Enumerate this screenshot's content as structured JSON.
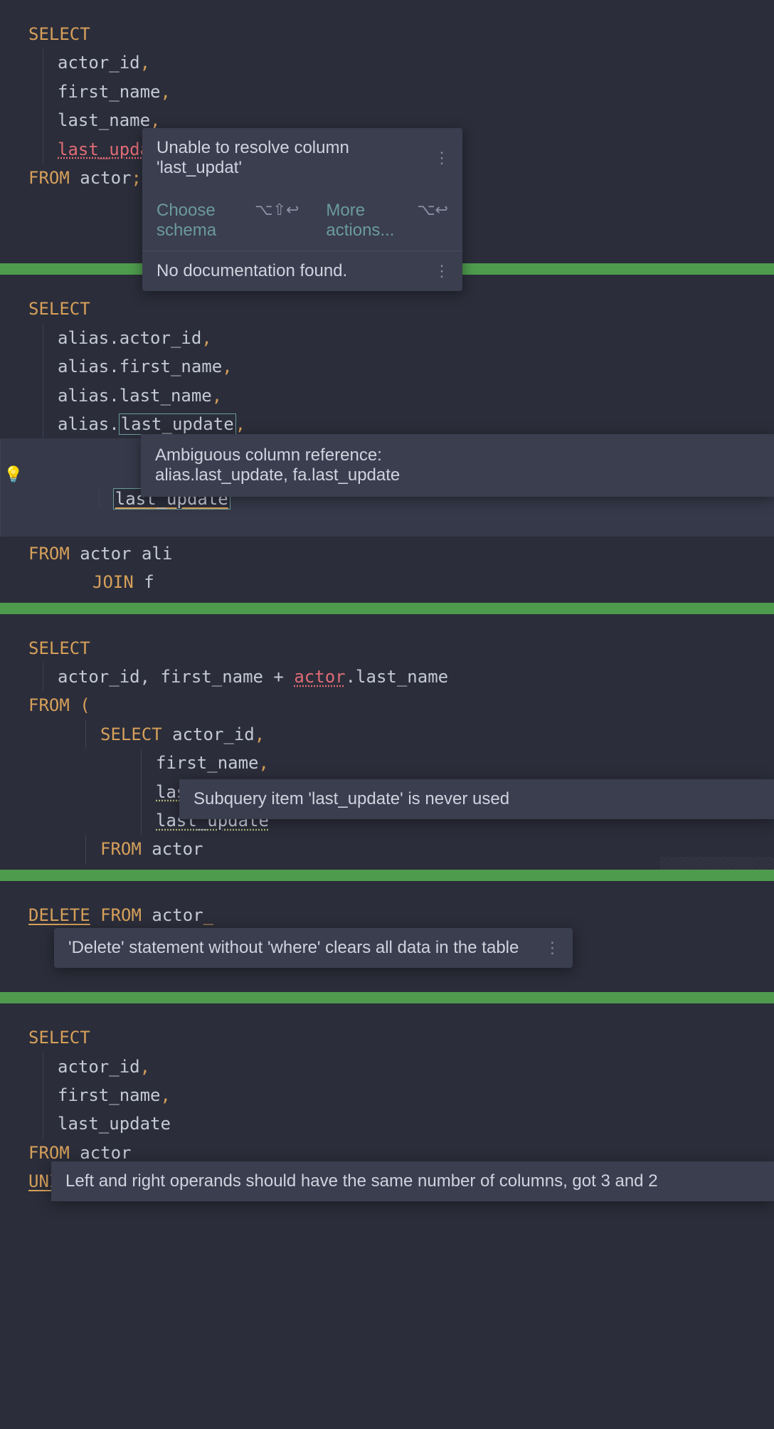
{
  "section1": {
    "code": {
      "select": "SELECT",
      "col1": "actor_id",
      "col2": "first_name",
      "col3": "last_name",
      "col4_err": "last_updat",
      "from": "FROM",
      "table": "actor",
      "semi": ";"
    },
    "popup": {
      "title": "Unable to resolve column 'last_updat'",
      "action1": "Choose schema",
      "shortcut1": "⌥⇧↩",
      "action2": "More actions...",
      "shortcut2": "⌥↩",
      "docmsg": "No documentation found."
    }
  },
  "section2": {
    "code": {
      "select": "SELECT",
      "c1": "alias.actor_id",
      "c2": "alias.first_name",
      "c3": "alias.last_name",
      "c4_pre": "alias.",
      "c4_box": "last_update",
      "c5_box": "last_update",
      "from": "FROM",
      "table": "actor",
      "alias": "ali",
      "join": "JOIN",
      "jtbl": "f"
    },
    "tooltip": "Ambiguous column reference: alias.last_update, fa.last_update"
  },
  "section3": {
    "code": {
      "select": "SELECT",
      "expr_pre": "actor_id, first_name + ",
      "expr_err": "actor",
      "expr_post": ".last_name",
      "from": "FROM",
      "paren": "(",
      "sub_select": "SELECT",
      "sc1": "actor_id",
      "sc2": "first_name",
      "sc3": "last_name",
      "sc4": "last_update",
      "sub_from": "FROM",
      "sub_table": "actor"
    },
    "tooltip": "Subquery item 'last_update' is never used"
  },
  "section4": {
    "code": {
      "delete": "DELETE",
      "from": "FROM",
      "table": "actor"
    },
    "tooltip": "'Delete' statement without 'where' clears all data in the table"
  },
  "section5": {
    "code": {
      "select": "SELECT",
      "c1": "actor_id",
      "c2": "first_name",
      "c3": "last_update",
      "from": "FROM",
      "table": "actor",
      "union": "UNION"
    },
    "tooltip": "Left and right operands should have the same number of columns, got 3 and 2"
  }
}
